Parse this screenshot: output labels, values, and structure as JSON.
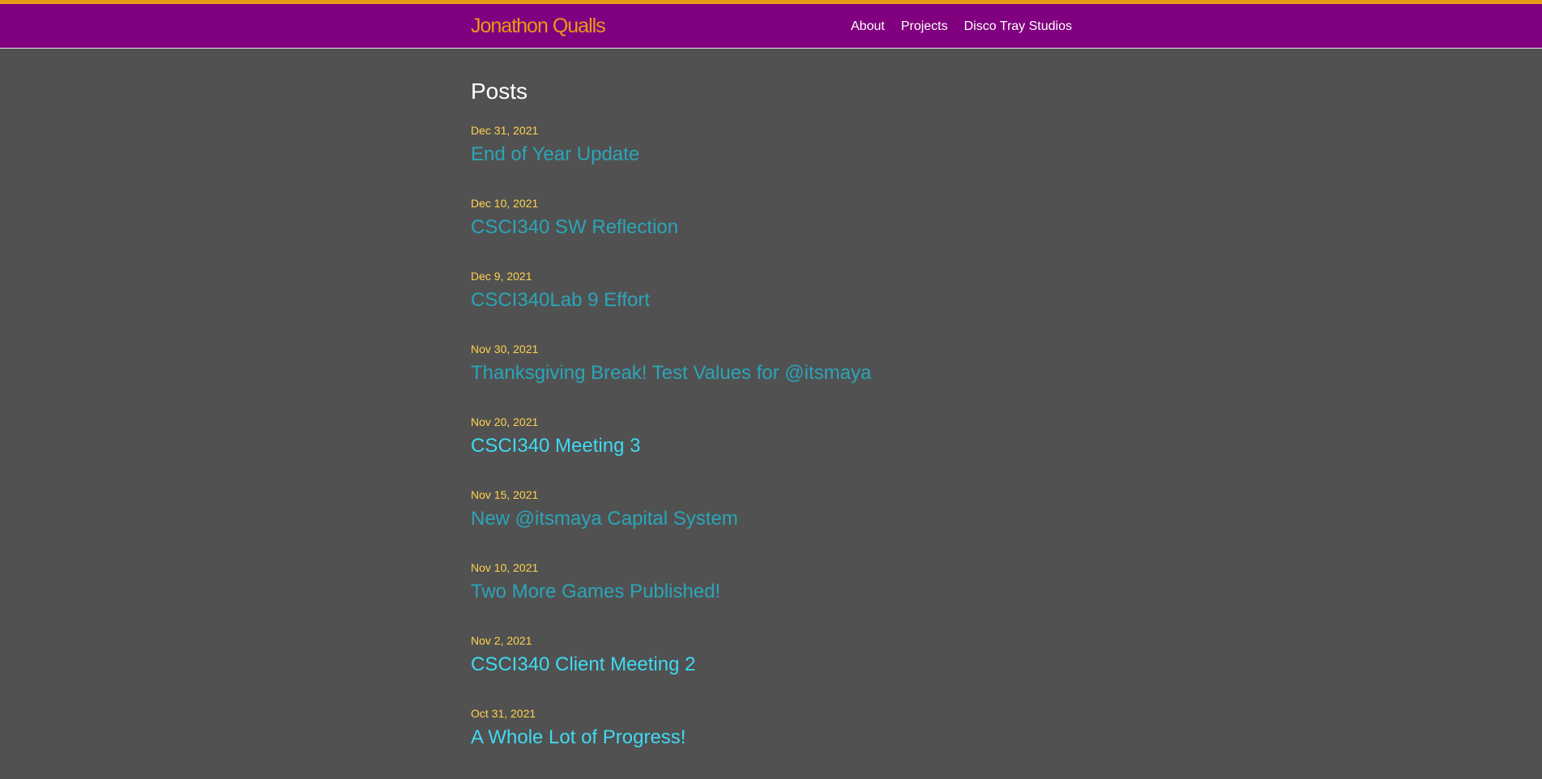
{
  "header": {
    "site_title": "Jonathon Qualls",
    "nav": [
      {
        "label": "About"
      },
      {
        "label": "Projects"
      },
      {
        "label": "Disco Tray Studios"
      }
    ]
  },
  "main": {
    "heading": "Posts",
    "posts": [
      {
        "date": "Dec 31, 2021",
        "title": "End of Year Update"
      },
      {
        "date": "Dec 10, 2021",
        "title": "CSCI340 SW Reflection"
      },
      {
        "date": "Dec 9, 2021",
        "title": "CSCI340Lab 9 Effort"
      },
      {
        "date": "Nov 30, 2021",
        "title": "Thanksgiving Break! Test Values for @itsmaya"
      },
      {
        "date": "Nov 20, 2021",
        "title": "CSCI340 Meeting 3"
      },
      {
        "date": "Nov 15, 2021",
        "title": "New @itsmaya Capital System"
      },
      {
        "date": "Nov 10, 2021",
        "title": "Two More Games Published!"
      },
      {
        "date": "Nov 2, 2021",
        "title": "CSCI340 Client Meeting 2"
      },
      {
        "date": "Oct 31, 2021",
        "title": "A Whole Lot of Progress!"
      }
    ]
  },
  "colors": {
    "header_bg": "#800080",
    "accent_orange": "#e79a16",
    "page_bg": "#515151",
    "date_yellow": "#ffd24d",
    "link_teal": "#2aa5b9",
    "link_cyan_bright": "#3fd9f3"
  }
}
